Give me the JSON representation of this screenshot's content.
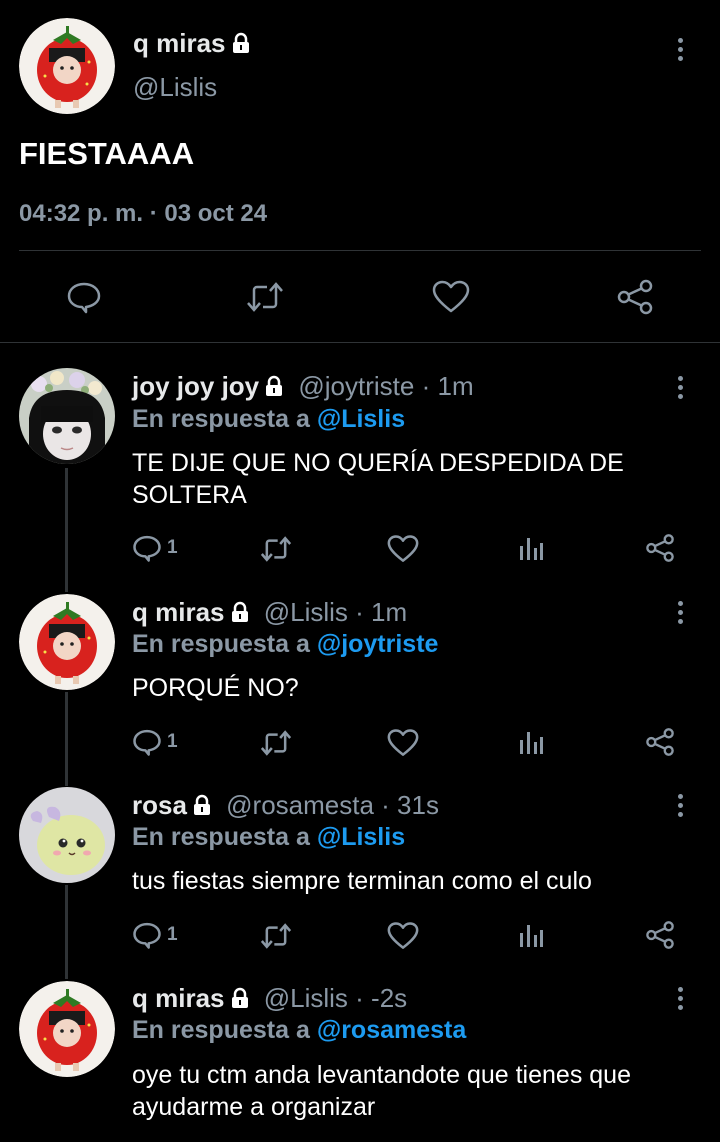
{
  "main_tweet": {
    "display_name": "q miras",
    "handle": "@Lislis",
    "text": "FIESTAAAA",
    "timestamp": "04:32 p. m. · 03 oct 24"
  },
  "replies": [
    {
      "display_name": "joy joy joy",
      "handle": "@joytriste",
      "time": "· 1m",
      "reply_label": "En respuesta a",
      "reply_to": "@Lislis",
      "text_lines": [
        "TE DIJE QUE NO QUERÍA DESPEDIDA DE",
        "SOLTERA"
      ],
      "reply_count": "1"
    },
    {
      "display_name": "q miras",
      "handle": "@Lislis",
      "time": "· 1m",
      "reply_label": "En respuesta a",
      "reply_to": "@joytriste",
      "text_lines": [
        "PORQUÉ NO?"
      ],
      "reply_count": "1"
    },
    {
      "display_name": "rosa",
      "handle": "@rosamesta",
      "time": "· 31s",
      "reply_label": "En respuesta a",
      "reply_to": "@Lislis",
      "text_lines": [
        "tus fiestas siempre terminan como el culo"
      ],
      "reply_count": "1"
    },
    {
      "display_name": "q miras",
      "handle": "@Lislis",
      "time": "· -2s",
      "reply_label": "En respuesta a",
      "reply_to": "@rosamesta",
      "text_lines": [
        "oye tu ctm anda levantandote que tienes que",
        "ayudarme a organizar"
      ]
    }
  ],
  "colors": {
    "background": "#000000",
    "text": "#e7e9ea",
    "secondary": "#8b98a5",
    "link": "#1d9bf0"
  }
}
